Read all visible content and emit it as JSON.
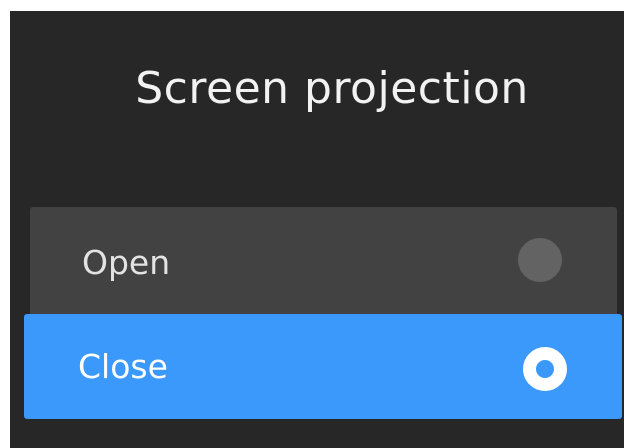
{
  "dialog": {
    "title": "Screen projection",
    "options": [
      {
        "label": "Open",
        "selected": false
      },
      {
        "label": "Close",
        "selected": true
      }
    ]
  },
  "colors": {
    "background": "#272727",
    "option_background": "#424242",
    "selected_background": "#3b99fc",
    "radio_unselected": "#636363",
    "radio_selected_ring": "#ffffff"
  },
  "icons": {
    "radio_unselected": "radio-unselected-icon",
    "radio_selected": "radio-selected-icon"
  }
}
